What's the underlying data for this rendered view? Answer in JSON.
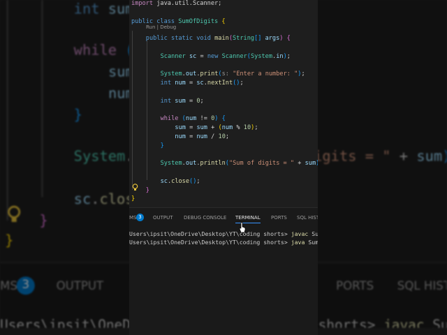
{
  "editor": {
    "codelens": "Run | Debug",
    "lines": [
      {
        "row": 0,
        "indent": 0,
        "tokens": [
          [
            "import",
            "ctl"
          ],
          [
            " java.util.Scanner;",
            "p"
          ]
        ]
      },
      {
        "row": 2,
        "indent": 0,
        "tokens": [
          [
            "public class ",
            "kw"
          ],
          [
            "SumOfDigits",
            "ty"
          ],
          [
            " ",
            "p"
          ],
          [
            "{",
            "b1"
          ]
        ]
      },
      {
        "row": 3.9,
        "indent": 4,
        "tokens": [
          [
            "public static void ",
            "kw"
          ],
          [
            "main",
            "fn"
          ],
          [
            "(",
            "b2"
          ],
          [
            "String",
            "ty"
          ],
          [
            "[]",
            "b3"
          ],
          [
            " args",
            "v"
          ],
          [
            ")",
            "b2"
          ],
          [
            " ",
            "p"
          ],
          [
            "{",
            "b2"
          ]
        ]
      },
      {
        "row": 5.9,
        "indent": 8,
        "tokens": [
          [
            "Scanner",
            "ty"
          ],
          [
            " sc ",
            "v"
          ],
          [
            "= ",
            "p"
          ],
          [
            "new ",
            "kw"
          ],
          [
            "Scanner",
            "ty"
          ],
          [
            "(",
            "b3"
          ],
          [
            "System",
            "ty"
          ],
          [
            ".",
            "p"
          ],
          [
            "in",
            "v"
          ],
          [
            ")",
            "b3"
          ],
          [
            ";",
            "p"
          ]
        ]
      },
      {
        "row": 7.9,
        "indent": 8,
        "tokens": [
          [
            "System",
            "ty"
          ],
          [
            ".",
            "p"
          ],
          [
            "out",
            "v"
          ],
          [
            ".",
            "p"
          ],
          [
            "print",
            "fn"
          ],
          [
            "(",
            "b3"
          ],
          [
            "s: ",
            "lbl"
          ],
          [
            "\"Enter a number: \"",
            "str"
          ],
          [
            ")",
            "b3"
          ],
          [
            ";",
            "p"
          ]
        ]
      },
      {
        "row": 8.9,
        "indent": 8,
        "tokens": [
          [
            "int ",
            "kw"
          ],
          [
            "num ",
            "v"
          ],
          [
            "= ",
            "p"
          ],
          [
            "sc",
            "v"
          ],
          [
            ".",
            "p"
          ],
          [
            "nextInt",
            "fn"
          ],
          [
            "()",
            "b3"
          ],
          [
            ";",
            "p"
          ]
        ]
      },
      {
        "row": 10.9,
        "indent": 8,
        "tokens": [
          [
            "int ",
            "kw"
          ],
          [
            "sum ",
            "v"
          ],
          [
            "= ",
            "p"
          ],
          [
            "0",
            "num"
          ],
          [
            ";",
            "p"
          ]
        ]
      },
      {
        "row": 12.9,
        "indent": 8,
        "tokens": [
          [
            "while ",
            "ctl"
          ],
          [
            "(",
            "b3"
          ],
          [
            "num ",
            "v"
          ],
          [
            "!= ",
            "p"
          ],
          [
            "0",
            "num"
          ],
          [
            ")",
            "b3"
          ],
          [
            " ",
            "p"
          ],
          [
            "{",
            "b3"
          ]
        ]
      },
      {
        "row": 13.9,
        "indent": 12,
        "tokens": [
          [
            "sum ",
            "v"
          ],
          [
            "= ",
            "p"
          ],
          [
            "sum ",
            "v"
          ],
          [
            "+ ",
            "p"
          ],
          [
            "(",
            "b1"
          ],
          [
            "num ",
            "v"
          ],
          [
            "% ",
            "p"
          ],
          [
            "10",
            "num"
          ],
          [
            ")",
            "b1"
          ],
          [
            ";",
            "p"
          ]
        ]
      },
      {
        "row": 14.9,
        "indent": 12,
        "tokens": [
          [
            "num ",
            "v"
          ],
          [
            "= ",
            "p"
          ],
          [
            "num ",
            "v"
          ],
          [
            "/ ",
            "p"
          ],
          [
            "10",
            "num"
          ],
          [
            ";",
            "p"
          ]
        ]
      },
      {
        "row": 15.9,
        "indent": 8,
        "tokens": [
          [
            "}",
            "b3"
          ]
        ]
      },
      {
        "row": 17.9,
        "indent": 8,
        "tokens": [
          [
            "System",
            "ty"
          ],
          [
            ".",
            "p"
          ],
          [
            "out",
            "v"
          ],
          [
            ".",
            "p"
          ],
          [
            "println",
            "fn"
          ],
          [
            "(",
            "b3"
          ],
          [
            "\"Sum of digits = \"",
            "str"
          ],
          [
            " + ",
            "p"
          ],
          [
            "sum",
            "v"
          ],
          [
            ")",
            "b3"
          ]
        ]
      },
      {
        "row": 19.9,
        "indent": 8,
        "tokens": [
          [
            "sc",
            "v"
          ],
          [
            ".",
            "p"
          ],
          [
            "close",
            "fn"
          ],
          [
            "()",
            "b3"
          ],
          [
            ";",
            "p"
          ]
        ]
      },
      {
        "row": 20.9,
        "indent": 4,
        "tokens": [
          [
            "}",
            "b2"
          ]
        ]
      },
      {
        "row": 21.9,
        "indent": 0,
        "tokens": [
          [
            "}",
            "b1"
          ]
        ]
      }
    ]
  },
  "panel": {
    "tabs": [
      "MS",
      "OUTPUT",
      "DEBUG CONSOLE",
      "TERMINAL",
      "PORTS",
      "SQL HIST"
    ],
    "problems_count": "3",
    "active_tab": "TERMINAL"
  },
  "terminal": {
    "prompt": "Users\\ipsit\\OneDrive\\Desktop\\YT\\coding shorts> ",
    "lines": [
      {
        "cmd": "javac",
        "arg": " SumOfD"
      },
      {
        "cmd": "java",
        "arg": " SumOfDi"
      }
    ]
  },
  "colors": {
    "accent": "#3794ff",
    "badge": "#007acc",
    "bg": "#1e1e1e"
  }
}
